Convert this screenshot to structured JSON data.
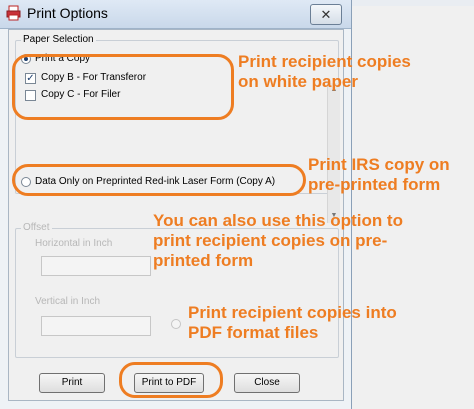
{
  "window": {
    "title": "Print Options",
    "close_glyph": "✕"
  },
  "paper_selection": {
    "group_label": "Paper Selection",
    "print_copy_label": "Print a Copy",
    "copy_b_label": "Copy B - For Transferor",
    "copy_b_checked": true,
    "copy_c_label": "Copy C - For Filer",
    "copy_c_checked": false,
    "data_only_label": "Data Only on Preprinted Red-ink Laser Form (Copy A)"
  },
  "offset": {
    "group_label": "Offset",
    "horizontal_label": "Horizontal in Inch",
    "horizontal_value": "",
    "vertical_label": "Vertical in Inch",
    "vertical_value": ""
  },
  "buttons": {
    "print": "Print",
    "print_to_pdf": "Print to PDF",
    "close": "Close"
  },
  "callouts": {
    "c1_line1": "Print recipient copies",
    "c1_line2": "on white paper",
    "c2_line1": "Print IRS copy on",
    "c2_line2": "pre-printed form",
    "c3_line1": "You can also use this option to",
    "c3_line2": "print recipient copies on pre-",
    "c3_line3": "printed form",
    "c4_line1": "Print recipient copies into",
    "c4_line2": "PDF format files"
  },
  "colors": {
    "annotation": "#ee7d22"
  }
}
